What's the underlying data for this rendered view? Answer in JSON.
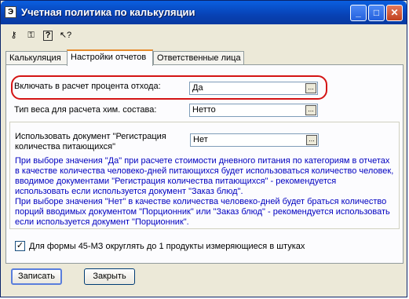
{
  "window": {
    "title": "Учетная политика по калькуляции",
    "app_icon": "Э",
    "controls": {
      "minimize": "_",
      "maximize": "□",
      "close": "✕"
    }
  },
  "toolbar": {
    "icons": [
      "open-lock-icon",
      "lock-icon",
      "help-icon",
      "whats-this-icon"
    ],
    "glyphs": [
      "⚷",
      "⚿",
      "?",
      "↖?"
    ]
  },
  "tabs": [
    {
      "label": "Калькуляция",
      "active": false
    },
    {
      "label": "Настройки отчетов",
      "active": true
    },
    {
      "label": "Ответственные лица",
      "active": false
    }
  ],
  "settings": {
    "waste_percent": {
      "label": "Включать в расчет процента отхода:",
      "value": "Да"
    },
    "weight_type": {
      "label": "Тип веса для расчета хим. состава:",
      "value": "Нетто"
    },
    "registration_doc": {
      "label_line1": "Использовать документ \"Регистрация",
      "label_line2": "количества питающихся\"",
      "value": "Нет"
    },
    "ellipsis": "...",
    "info_lines": [
      "При выборе значения \"Да\" при расчете стоимости дневного питания  по категориям в отчетах",
      "в качестве количества человеко-дней питающихся будет использоваться количество человек,",
      "вводимое документами \"Регистрация количества питающихся\" - рекомендуется",
      "использовать если используется  документ \"Заказ блюд\".",
      "При выборе значения \"Нет\" в качестве количества человеко-дней будет браться количество",
      "порций вводимых документом \"Порционник\" или \"Заказ блюд\" - рекомендуется использовать",
      "если используется документ \"Порционник\"."
    ],
    "round_checkbox": {
      "label": "Для формы 45-МЗ округлять до 1 продукты измеряющиеся в штуках",
      "checked": true,
      "mark": "✓"
    }
  },
  "buttons": {
    "save": "Записать",
    "close": "Закрыть"
  },
  "colors": {
    "accent": "#0a5fe0",
    "info_text": "#0000c0",
    "highlight": "#d41414"
  }
}
